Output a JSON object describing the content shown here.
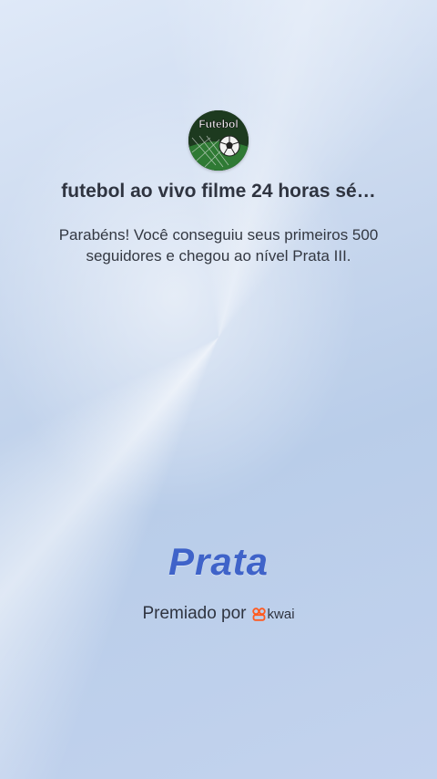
{
  "profile": {
    "avatar_text": "Futebol",
    "title": "futebol ao vivo filme 24 horas sé…"
  },
  "message": {
    "text": "Parabéns! Você conseguiu seus primeiros 500 seguidores e chegou ao nível Prata III."
  },
  "level": {
    "badge_label": "Prata",
    "badge_color": "#3f63c9"
  },
  "footer": {
    "awarded_by": "Premiado por",
    "brand_name": "kwai",
    "brand_icon": "kwai-logo-icon",
    "brand_color": "#ff5a1f"
  }
}
